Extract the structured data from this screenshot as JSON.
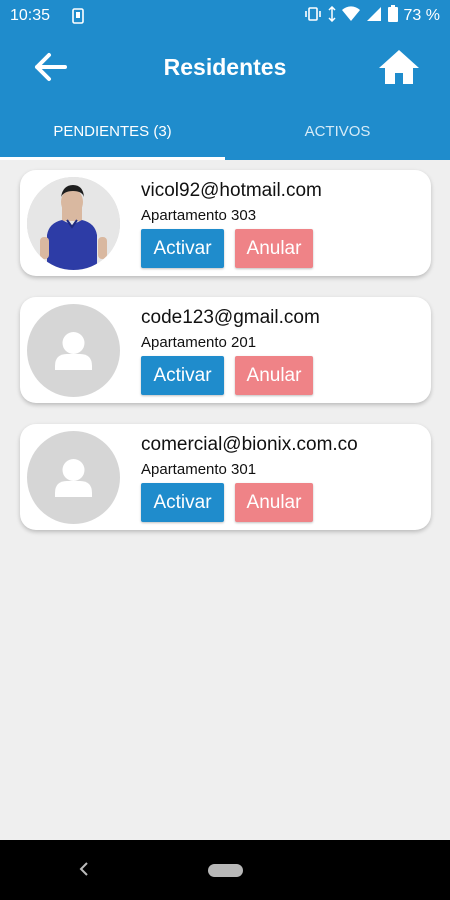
{
  "status_bar": {
    "time": "10:35",
    "battery": "73 %"
  },
  "app_bar": {
    "title": "Residentes"
  },
  "tabs": [
    {
      "label": "PENDIENTES (3)",
      "active": true
    },
    {
      "label": "ACTIVOS",
      "active": false
    }
  ],
  "residents": [
    {
      "email": "vicol92@hotmail.com",
      "apartment": "Apartamento 303",
      "avatar": "photo",
      "activate_label": "Activar",
      "cancel_label": "Anular"
    },
    {
      "email": "code123@gmail.com",
      "apartment": "Apartamento 201",
      "avatar": "placeholder",
      "activate_label": "Activar",
      "cancel_label": "Anular"
    },
    {
      "email": "comercial@bionix.com.co",
      "apartment": "Apartamento 301",
      "avatar": "placeholder",
      "activate_label": "Activar",
      "cancel_label": "Anular"
    }
  ],
  "colors": {
    "primary": "#1f8ccc",
    "cancel": "#ef8387",
    "background": "#efefef"
  }
}
